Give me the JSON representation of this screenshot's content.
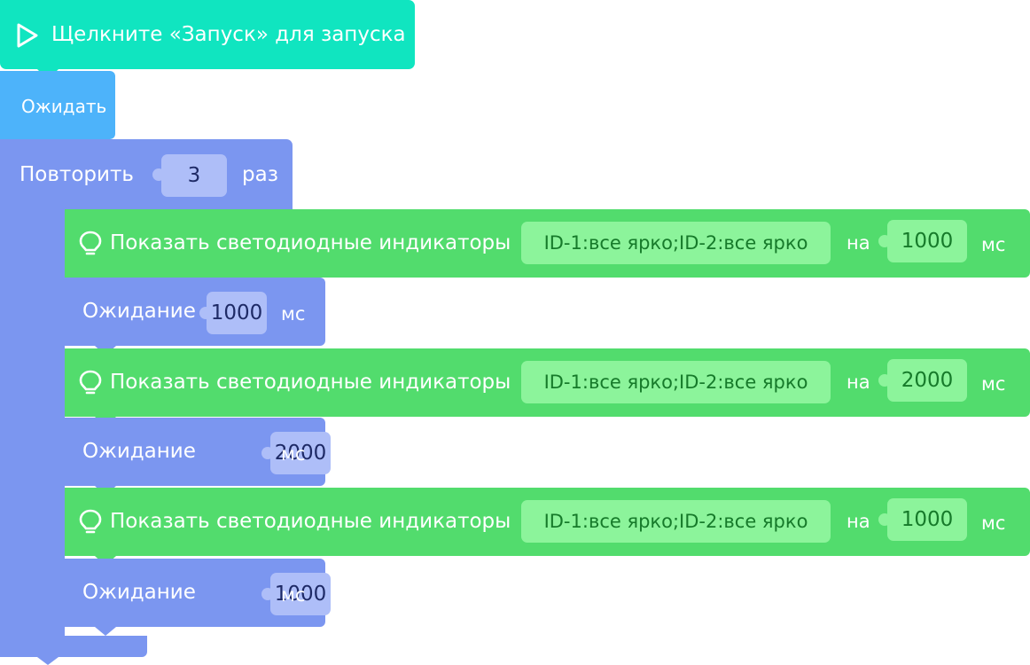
{
  "start": {
    "label": "Щелкните «Запуск» для запуска",
    "icon": "play-outline-icon"
  },
  "wait": {
    "label": "Ожидать"
  },
  "repeat": {
    "label": "Повторить",
    "count": "3",
    "unit": "раз"
  },
  "blocks": [
    {
      "type": "led",
      "label": "Показать светодиодные индикаторы",
      "setting": "ID-1:все ярко;ID-2:все ярко",
      "on_label": "на",
      "duration": "1000",
      "unit": "мс",
      "icon": "bulb-icon"
    },
    {
      "type": "wait",
      "label": "Ожидание",
      "duration": "1000",
      "unit": "мс"
    },
    {
      "type": "led",
      "label": "Показать светодиодные индикаторы",
      "setting": "ID-1:все ярко;ID-2:все ярко",
      "on_label": "на",
      "duration": "2000",
      "unit": "мс",
      "icon": "bulb-icon"
    },
    {
      "type": "wait",
      "label": "Ожидание",
      "duration": "2000",
      "unit": "мс"
    },
    {
      "type": "led",
      "label": "Показать светодиодные индикаторы",
      "setting": "ID-1:все ярко;ID-2:все ярко",
      "on_label": "на",
      "duration": "1000",
      "unit": "мс",
      "icon": "bulb-icon"
    },
    {
      "type": "wait",
      "label": "Ожидание",
      "duration": "1000",
      "unit": "мс"
    }
  ],
  "colors": {
    "start": "#10E5C0",
    "wait": "#4DB3FA",
    "control": "#7B96F0",
    "led": "#52DC6D",
    "led_field": "#8CF49B",
    "control_slot": "#AEBEF8"
  }
}
